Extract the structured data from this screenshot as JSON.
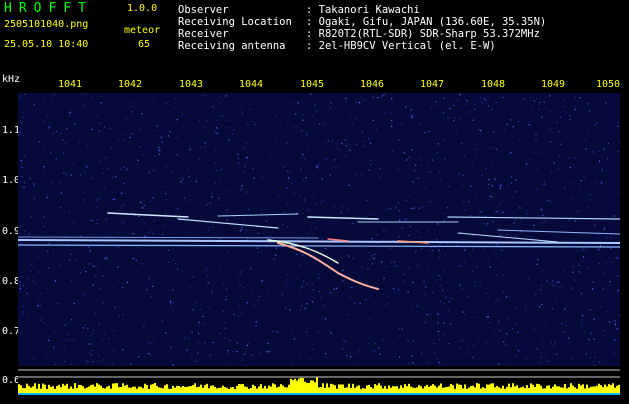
{
  "app": {
    "title": "HROFFT",
    "version": "1.0.0"
  },
  "file": {
    "name": "2505101040.png",
    "datetime": "25.05.10 10:40"
  },
  "meteor": {
    "label": "meteor",
    "count": "65"
  },
  "info": [
    {
      "label": "Observer",
      "value": ": Takanori Kawachi"
    },
    {
      "label": "Receiving Location",
      "value": ": Ogaki, Gifu, JAPAN (136.60E, 35.35N)"
    },
    {
      "label": "Receiver",
      "value": ": R820T2(RTL-SDR) SDR-Sharp 53.372MHz"
    },
    {
      "label": "Receiving antenna",
      "value": ": 2el-HB9CV Vertical (el. E-W)"
    }
  ],
  "freq_axis": {
    "unit": "kHz",
    "ticks": [
      "1041",
      "1042",
      "1043",
      "1044",
      "1045",
      "1046",
      "1047",
      "1048",
      "1049",
      "1050"
    ]
  },
  "y_axis": {
    "ticks": [
      "1.1",
      "1.0",
      "0.9",
      "0.8",
      "0.7",
      "0.6"
    ]
  },
  "colors": {
    "background": "#000000",
    "waterfall": "#050a3a",
    "accent_yellow": "#ffff00",
    "accent_green": "#00ff00",
    "signal": "#c8e8ff"
  }
}
